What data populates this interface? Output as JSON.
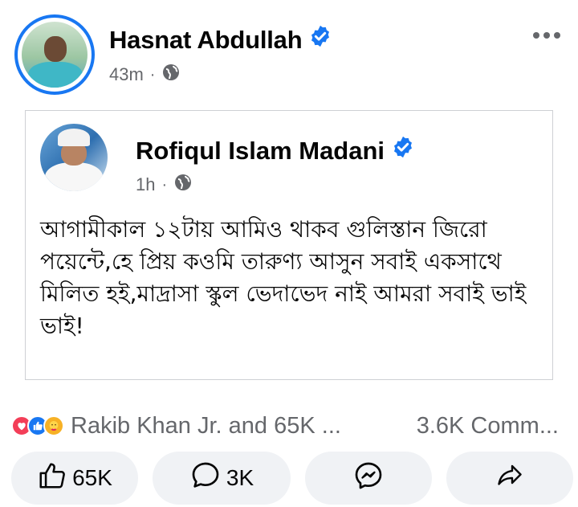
{
  "post": {
    "author": "Hasnat Abdullah",
    "time": "43m",
    "separator": "·",
    "audience_icon": "globe-icon",
    "more_icon": "more-horizontal-icon",
    "verified_icon": "verified-badge-icon"
  },
  "shared_post": {
    "author": "Rofiqul Islam Madani",
    "time": "1h",
    "separator": "·",
    "audience_icon": "globe-icon",
    "text": "আগামীকাল ১২টায় আমিও থাকব গুলিস্তান জিরো পয়েন্টে,হে প্রিয় কওমি তারুণ্য আসুন সবাই একসাথে মিলিত হই,মাদ্রাসা স্কুল ভেদাভেদ নাই আমরা সবাই ভাই ভাই!"
  },
  "summary": {
    "reaction_icons": [
      "love-reaction-icon",
      "like-reaction-icon",
      "care-reaction-icon"
    ],
    "reactions_text": "Rakib Khan Jr. and 65K ...",
    "comments_text": "3.6K Comm..."
  },
  "actions": {
    "like_count": "65K",
    "comment_count": "3K"
  },
  "colors": {
    "accent": "#1877f2",
    "secondary_text": "#65676b",
    "button_bg": "#f0f2f5",
    "love": "#f33e58",
    "care": "#f7b125"
  }
}
